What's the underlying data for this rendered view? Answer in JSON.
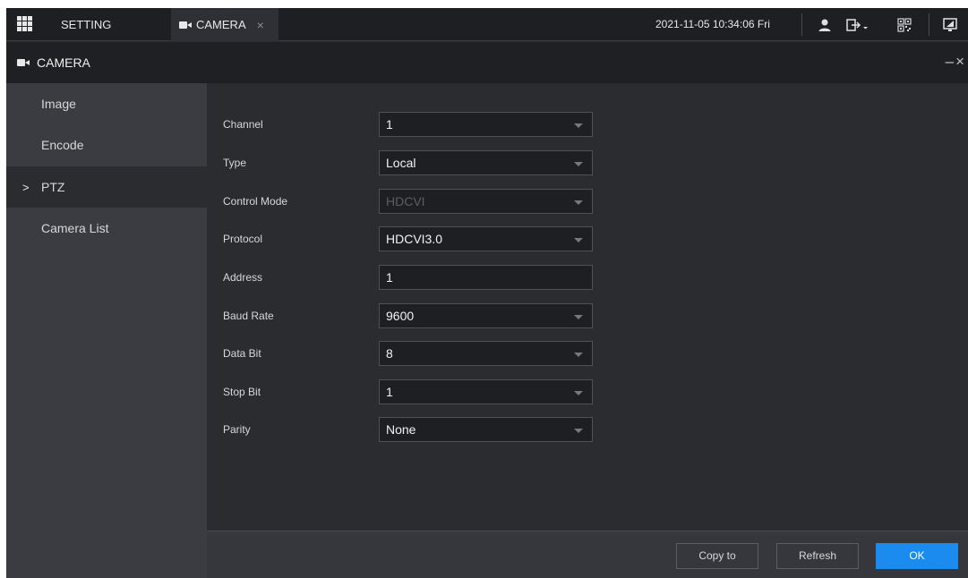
{
  "topbar": {
    "setting_label": "SETTING",
    "camera_tab_label": "CAMERA",
    "close_glyph": "×",
    "datetime": "2021-11-05 10:34:06 Fri",
    "icons": [
      "user-icon",
      "logout-icon",
      "qrcode-icon",
      "display-icon"
    ]
  },
  "header": {
    "title": "CAMERA",
    "minimize_glyph": "–",
    "close_glyph": "×"
  },
  "sidebar": {
    "items": [
      {
        "label": "Image",
        "active": false
      },
      {
        "label": "Encode",
        "active": false
      },
      {
        "label": "PTZ",
        "active": true
      },
      {
        "label": "Camera List",
        "active": false
      }
    ],
    "active_marker": ">"
  },
  "form": {
    "channel": {
      "label": "Channel",
      "value": "1"
    },
    "type": {
      "label": "Type",
      "value": "Local"
    },
    "control_mode": {
      "label": "Control Mode",
      "value": "HDCVI"
    },
    "protocol": {
      "label": "Protocol",
      "value": "HDCVI3.0"
    },
    "address": {
      "label": "Address",
      "value": "1"
    },
    "baud_rate": {
      "label": "Baud Rate",
      "value": "9600"
    },
    "data_bit": {
      "label": "Data Bit",
      "value": "8"
    },
    "stop_bit": {
      "label": "Stop Bit",
      "value": "1"
    },
    "parity": {
      "label": "Parity",
      "value": "None"
    }
  },
  "footer": {
    "copy_label": "Copy to",
    "refresh_label": "Refresh",
    "ok_label": "OK"
  },
  "colors": {
    "accent": "#1c8bf0",
    "background": "#2b2c30",
    "sidebar": "#3b3c41"
  }
}
